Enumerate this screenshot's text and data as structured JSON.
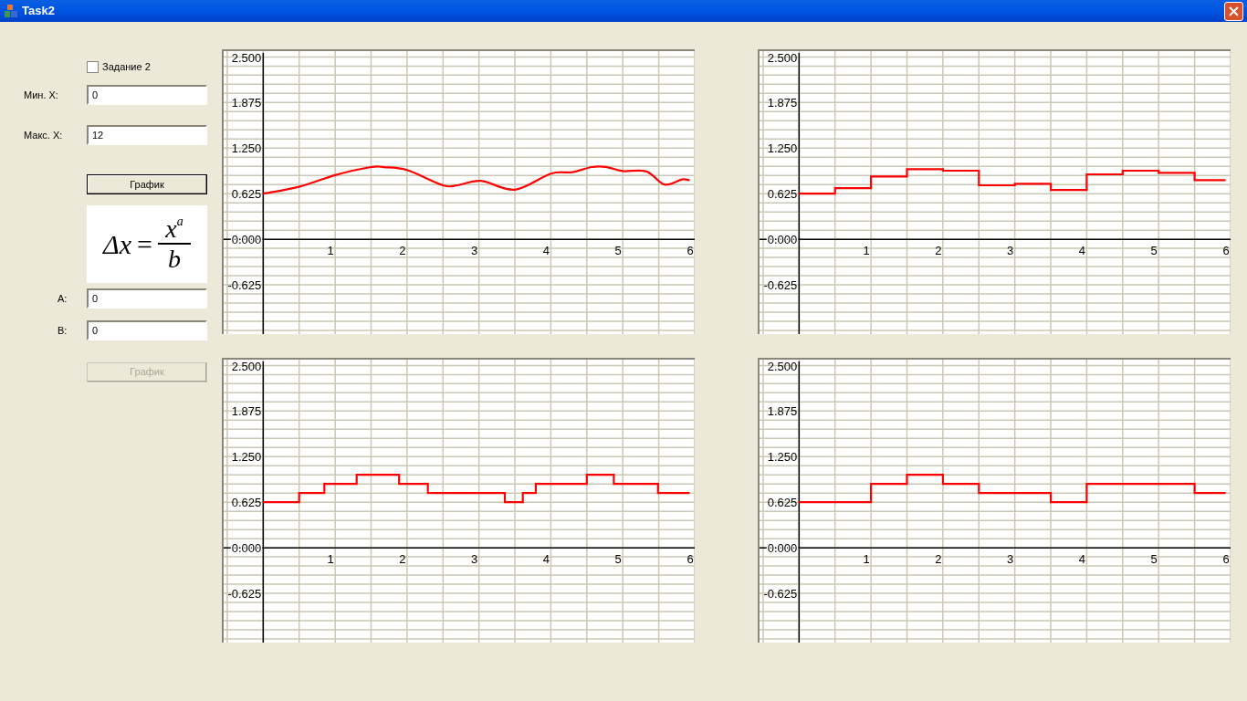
{
  "window": {
    "title": "Task2"
  },
  "options": {
    "task2": {
      "label": "Задание 2",
      "checked": false
    }
  },
  "fields": [
    {
      "label": "Мин. X:",
      "value": "0"
    },
    {
      "label": "Макс. X:",
      "value": "12"
    }
  ],
  "plot_button": {
    "label": "График",
    "disabled": false
  },
  "formula": {
    "lhs": "Δx",
    "equals": "=",
    "numerator": "x",
    "exponent": "a",
    "denominator": "b"
  },
  "params": [
    {
      "label": "А:",
      "value": "0"
    },
    {
      "label": "В:",
      "value": "0"
    }
  ],
  "params_button": {
    "label": "График",
    "disabled": true
  },
  "charts": [
    {
      "chart_data": {
        "type": "line",
        "grid": true,
        "xlim": [
          -0.55,
          6
        ],
        "ylim": [
          -1.3,
          2.58
        ],
        "xticks": [
          1,
          2,
          3,
          4,
          5,
          6
        ],
        "yticks": [
          {
            "value": 2.5,
            "label": "2.500"
          },
          {
            "value": 1.875,
            "label": "1.875"
          },
          {
            "value": 1.25,
            "label": "1.250"
          },
          {
            "value": 0.625,
            "label": "0.625"
          },
          {
            "value": 0,
            "label": "0.000"
          },
          {
            "value": -0.625,
            "label": "-0.625"
          }
        ],
        "x": [
          0,
          0.5,
          1,
          1.5,
          1.68,
          2,
          2.5,
          2.7,
          3.03,
          3.5,
          4,
          4.3,
          4.57,
          4.78,
          5,
          5.33,
          5.58,
          5.82,
          5.93
        ],
        "series": [
          {
            "color": "#ff0000",
            "values": [
              0.625,
              0.72,
              0.88,
              0.99,
              0.99,
              0.95,
              0.74,
              0.74,
              0.8,
              0.68,
              0.9,
              0.92,
              0.99,
              0.99,
              0.935,
              0.93,
              0.75,
              0.82,
              0.81
            ]
          }
        ]
      },
      "smooth": true
    },
    {
      "chart_data": {
        "type": "line",
        "grid": true,
        "xlim": [
          -0.55,
          6
        ],
        "ylim": [
          -1.3,
          2.58
        ],
        "xticks": [
          1,
          2,
          3,
          4,
          5,
          6
        ],
        "yticks": [
          {
            "value": 2.5,
            "label": "2.500"
          },
          {
            "value": 1.875,
            "label": "1.875"
          },
          {
            "value": 1.25,
            "label": "1.250"
          },
          {
            "value": 0.625,
            "label": "0.625"
          },
          {
            "value": 0,
            "label": "0.000"
          },
          {
            "value": -0.625,
            "label": "-0.625"
          }
        ],
        "x": [
          0,
          0.5,
          0.5,
          1,
          1,
          1.5,
          1.5,
          2,
          2,
          2.5,
          2.5,
          3,
          3,
          3.5,
          3.5,
          4,
          4,
          4.5,
          4.5,
          5,
          5,
          5.5,
          5.5,
          5.93
        ],
        "series": [
          {
            "color": "#ff0000",
            "values": [
              0.625,
              0.625,
              0.7,
              0.7,
              0.86,
              0.86,
              0.96,
              0.96,
              0.94,
              0.94,
              0.74,
              0.74,
              0.76,
              0.76,
              0.675,
              0.675,
              0.89,
              0.89,
              0.94,
              0.94,
              0.91,
              0.91,
              0.81,
              0.81
            ]
          }
        ]
      },
      "smooth": false
    },
    {
      "chart_data": {
        "type": "line",
        "grid": true,
        "xlim": [
          -0.55,
          6
        ],
        "ylim": [
          -1.3,
          2.58
        ],
        "xticks": [
          1,
          2,
          3,
          4,
          5,
          6
        ],
        "yticks": [
          {
            "value": 2.5,
            "label": "2.500"
          },
          {
            "value": 1.875,
            "label": "1.875"
          },
          {
            "value": 1.25,
            "label": "1.250"
          },
          {
            "value": 0.625,
            "label": "0.625"
          },
          {
            "value": 0,
            "label": "0.000"
          },
          {
            "value": -0.625,
            "label": "-0.625"
          }
        ],
        "x": [
          0,
          0.5,
          0.5,
          0.85,
          0.85,
          1.3,
          1.3,
          1.89,
          1.89,
          2.29,
          2.29,
          3.36,
          3.36,
          3.61,
          3.61,
          3.79,
          3.79,
          4.5,
          4.5,
          4.875,
          4.875,
          5.49,
          5.49,
          5.93
        ],
        "series": [
          {
            "color": "#ff0000",
            "values": [
              0.625,
              0.625,
              0.75,
              0.75,
              0.875,
              0.875,
              1,
              1,
              0.875,
              0.875,
              0.75,
              0.75,
              0.625,
              0.625,
              0.75,
              0.75,
              0.875,
              0.875,
              1,
              1,
              0.875,
              0.875,
              0.75,
              0.75
            ]
          }
        ]
      },
      "smooth": false
    },
    {
      "chart_data": {
        "type": "line",
        "grid": true,
        "xlim": [
          -0.55,
          6
        ],
        "ylim": [
          -1.3,
          2.58
        ],
        "xticks": [
          1,
          2,
          3,
          4,
          5,
          6
        ],
        "yticks": [
          {
            "value": 2.5,
            "label": "2.500"
          },
          {
            "value": 1.875,
            "label": "1.875"
          },
          {
            "value": 1.25,
            "label": "1.250"
          },
          {
            "value": 0.625,
            "label": "0.625"
          },
          {
            "value": 0,
            "label": "0.000"
          },
          {
            "value": -0.625,
            "label": "-0.625"
          }
        ],
        "x": [
          0,
          1,
          1,
          1.5,
          1.5,
          2,
          2,
          2.5,
          2.5,
          3.5,
          3.5,
          4,
          4,
          5.5,
          5.5,
          5.93
        ],
        "series": [
          {
            "color": "#ff0000",
            "values": [
              0.625,
              0.625,
              0.875,
              0.875,
              1,
              1,
              0.875,
              0.875,
              0.75,
              0.75,
              0.625,
              0.625,
              0.875,
              0.875,
              0.75,
              0.75
            ]
          }
        ]
      },
      "smooth": false
    }
  ]
}
